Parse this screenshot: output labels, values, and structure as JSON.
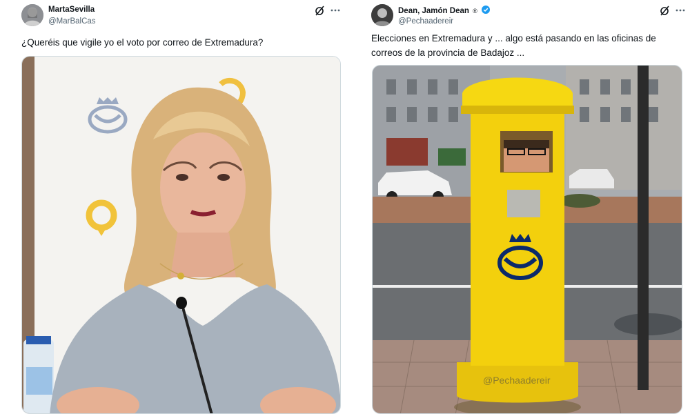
{
  "left_tweet": {
    "display_name": "MartaSevilla",
    "handle": "@MarBalCas",
    "text": "¿Queréis que vigile yo el voto por correo de Extremadura?",
    "media_icon": "correos-logo-icon"
  },
  "right_tweet": {
    "display_name": "Dean, Jamón Dean",
    "registered_mark": "®",
    "handle": "@Pechaadereir",
    "text": "Elecciones en Extremadura y ... algo está pasando en las oficinas de correos de la provincia de Badajoz ...",
    "media_watermark": "@Pechaadereir",
    "verified_color": "#1d9bf0"
  },
  "icons": [
    "grok-icon",
    "more-icon",
    "verified-badge-icon"
  ],
  "colors": {
    "correos_yellow": "#f6d20a",
    "correos_blue": "#002f6c",
    "secondary_text": "#536471"
  }
}
